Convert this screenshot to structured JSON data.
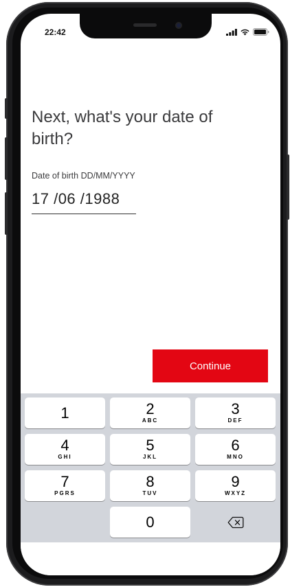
{
  "status_bar": {
    "time": "22:42",
    "icons": [
      "signal-icon",
      "wifi-icon",
      "battery-icon"
    ]
  },
  "screen": {
    "title": "Next, what's your date of birth?",
    "dob_field": {
      "label": "Date of birth DD/MM/YYYY",
      "value": "17 /06 /1988"
    },
    "continue_label": "Continue"
  },
  "keypad": {
    "keys": [
      {
        "digit": "1",
        "letters": ""
      },
      {
        "digit": "2",
        "letters": "ABC"
      },
      {
        "digit": "3",
        "letters": "DEF"
      },
      {
        "digit": "4",
        "letters": "GHI"
      },
      {
        "digit": "5",
        "letters": "JKL"
      },
      {
        "digit": "6",
        "letters": "MNO"
      },
      {
        "digit": "7",
        "letters": "PGRS"
      },
      {
        "digit": "8",
        "letters": "TUV"
      },
      {
        "digit": "9",
        "letters": "WXYZ"
      },
      {
        "digit": "0",
        "letters": ""
      }
    ],
    "delete_icon": "backspace-icon"
  },
  "colors": {
    "accent": "#e30613",
    "keypad_background": "#d2d5db",
    "key_background": "#ffffff",
    "text": "#3a3a3c"
  }
}
